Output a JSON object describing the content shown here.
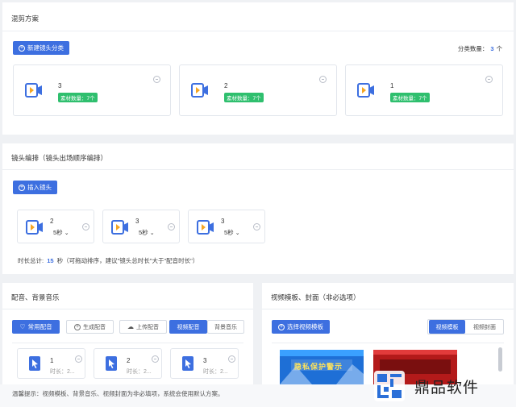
{
  "scheme": {
    "title": "混剪方案",
    "new_category_label": "新建镜头分类",
    "category_count_label": "分类数量：",
    "category_count": "3",
    "category_unit": "个",
    "cards": [
      {
        "num": "3",
        "badge": "素材数量：7个"
      },
      {
        "num": "2",
        "badge": "素材数量：7个"
      },
      {
        "num": "1",
        "badge": "素材数量：7个"
      }
    ]
  },
  "arrange": {
    "title": "镜头编排（镜头出场顺序编排）",
    "insert_label": "插入镜头",
    "shots": [
      {
        "num": "2",
        "duration": "5秒"
      },
      {
        "num": "3",
        "duration": "5秒"
      },
      {
        "num": "3",
        "duration": "5秒"
      }
    ],
    "total_prefix": "时长总计:",
    "total_value": "15",
    "total_suffix": "秒（可拖动排序，建议\"镜头总时长\"大于\"配音时长\"）"
  },
  "audio": {
    "title": "配音、背景音乐",
    "buttons": {
      "common": "常用配音",
      "generate": "生成配音",
      "upload": "上传配音",
      "video_dub": "视频配音",
      "bgm": "背景音乐"
    },
    "items": [
      {
        "num": "1",
        "len": "时长：2..."
      },
      {
        "num": "2",
        "len": "时长：2..."
      },
      {
        "num": "3",
        "len": "时长：2..."
      }
    ]
  },
  "template": {
    "title": "视频模板、封面（非必选项）",
    "select_label": "选择视频模板",
    "tab_template": "视频模板",
    "tab_cover": "视频封面",
    "thumb1_text": "隐私保护警示"
  },
  "tip": "温馨提示：视频模板、背景音乐、视频封面为非必填项，系统会使用默认方案。",
  "brand": {
    "name": "鼎品软件"
  },
  "colors": {
    "accent": "#3d6fe0",
    "badge_green": "#2fbf6e",
    "icon_orange": "#f5a623"
  }
}
